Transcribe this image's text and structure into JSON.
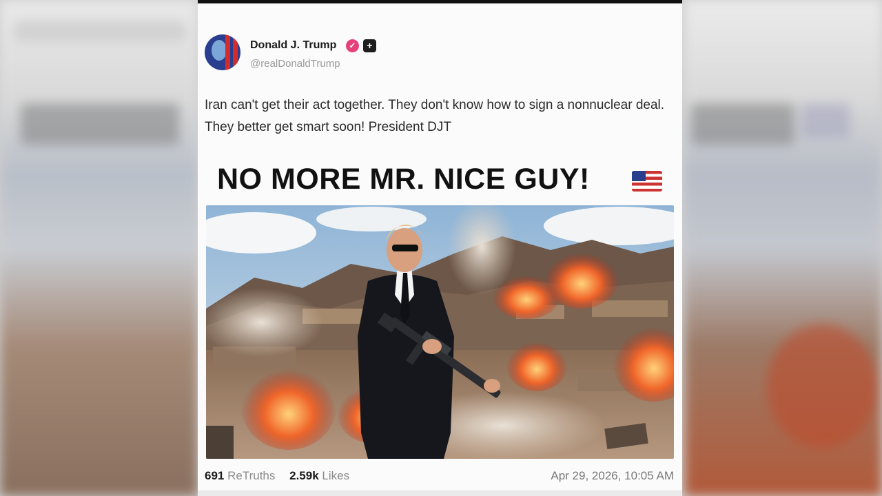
{
  "post": {
    "author_name": "Donald J. Trump",
    "handle": "@realDonaldTrump",
    "text": "Iran can't get their act together. They don't know how to sign a nonnuclear deal. They better get smart soon! President DJT",
    "headline": "NO MORE MR. NICE GUY!",
    "retruths_count": "691",
    "retruths_label": "ReTruths",
    "likes_count": "2.59k",
    "likes_label": "Likes",
    "timestamp": "Apr 29, 2026, 10:05 AM"
  },
  "icons": {
    "verified": "verified-badge-icon",
    "plus": "plus-badge-icon",
    "flag": "us-flag-icon"
  },
  "colors": {
    "verified": "#e6407a",
    "headline": "#111111",
    "handle": "#9a9a9a"
  }
}
